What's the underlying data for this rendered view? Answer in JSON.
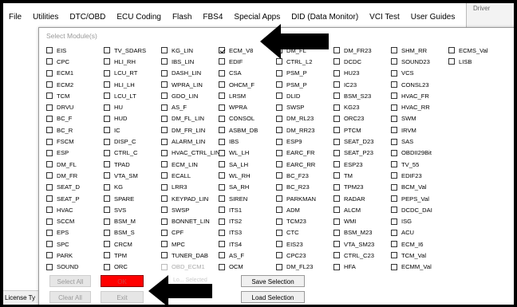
{
  "menubar": {
    "items": [
      "File",
      "Utilities",
      "DTC/OBD",
      "ECU Coding",
      "Flash",
      "FBS4",
      "Special Apps",
      "DID (Data Monitor)",
      "VCI Test",
      "User Guides"
    ]
  },
  "background": {
    "driver_text": "Driver",
    "license_text": "License Ty"
  },
  "dialog": {
    "title": "Select Module(s)",
    "columns": [
      [
        {
          "label": "EIS"
        },
        {
          "label": "CPC"
        },
        {
          "label": "ECM1"
        },
        {
          "label": "ECM2"
        },
        {
          "label": "TCM"
        },
        {
          "label": "DRVU"
        },
        {
          "label": "BC_F"
        },
        {
          "label": "BC_R"
        },
        {
          "label": "FSCM"
        },
        {
          "label": "ESP"
        },
        {
          "label": "DM_FL"
        },
        {
          "label": "DM_FR"
        },
        {
          "label": "SEAT_D"
        },
        {
          "label": "SEAT_P"
        },
        {
          "label": "HVAC"
        },
        {
          "label": "SCCM"
        },
        {
          "label": "EPS"
        },
        {
          "label": "SPC"
        },
        {
          "label": "PARK"
        },
        {
          "label": "SOUND"
        }
      ],
      [
        {
          "label": "TV_SDARS"
        },
        {
          "label": "HLI_RH"
        },
        {
          "label": "LCU_RT"
        },
        {
          "label": "HLI_LH"
        },
        {
          "label": "LCU_LT"
        },
        {
          "label": "HU"
        },
        {
          "label": "HUD"
        },
        {
          "label": "IC"
        },
        {
          "label": "DISP_C"
        },
        {
          "label": "CTRL_C"
        },
        {
          "label": "TPAD"
        },
        {
          "label": "VTA_SM"
        },
        {
          "label": "KG"
        },
        {
          "label": "SPARE"
        },
        {
          "label": "SVS"
        },
        {
          "label": "BSM_M"
        },
        {
          "label": "BSM_S"
        },
        {
          "label": "CRCM"
        },
        {
          "label": "TPM"
        },
        {
          "label": "ORC"
        }
      ],
      [
        {
          "label": "KG_LIN"
        },
        {
          "label": "IBS_LIN"
        },
        {
          "label": "DASH_LIN"
        },
        {
          "label": "WPRA_LIN"
        },
        {
          "label": "GDO_LIN"
        },
        {
          "label": "AS_F"
        },
        {
          "label": "DM_FL_LIN"
        },
        {
          "label": "DM_FR_LIN"
        },
        {
          "label": "ALARM_LIN"
        },
        {
          "label": "HVAC_CTRL_LIN"
        },
        {
          "label": "ECM_LIN"
        },
        {
          "label": "ECALL"
        },
        {
          "label": "LRR3"
        },
        {
          "label": "KEYPAD_LIN"
        },
        {
          "label": "SWSP"
        },
        {
          "label": "BONNET_LIN"
        },
        {
          "label": "CPF"
        },
        {
          "label": "MPC"
        },
        {
          "label": "TUNER_DAB"
        },
        {
          "label": "OBD_ECM1",
          "disabled": true
        }
      ],
      [
        {
          "label": "ECM_V8",
          "checked": true
        },
        {
          "label": "EDIF"
        },
        {
          "label": "CSA"
        },
        {
          "label": "OHCM_F"
        },
        {
          "label": "LRSM"
        },
        {
          "label": "WPRA"
        },
        {
          "label": "CONSOL"
        },
        {
          "label": "ASBM_DB"
        },
        {
          "label": "IBS"
        },
        {
          "label": "WL_LH"
        },
        {
          "label": "SA_LH"
        },
        {
          "label": "WL_RH"
        },
        {
          "label": "SA_RH"
        },
        {
          "label": "SIREN"
        },
        {
          "label": "ITS1"
        },
        {
          "label": "ITS2"
        },
        {
          "label": "ITS3"
        },
        {
          "label": "ITS4"
        },
        {
          "label": "AS_F"
        },
        {
          "label": "OCM"
        }
      ],
      [
        {
          "label": "DM_FL"
        },
        {
          "label": "CTRL_L2"
        },
        {
          "label": "PSM_P"
        },
        {
          "label": "PSM_P"
        },
        {
          "label": "DLID"
        },
        {
          "label": "SWSP"
        },
        {
          "label": "DM_RL23"
        },
        {
          "label": "DM_RR23"
        },
        {
          "label": "ESP9"
        },
        {
          "label": "EARC_FR"
        },
        {
          "label": "EARC_RR"
        },
        {
          "label": "BC_F23"
        },
        {
          "label": "BC_R23"
        },
        {
          "label": "PARKMAN"
        },
        {
          "label": "ADM"
        },
        {
          "label": "TCM23"
        },
        {
          "label": "CTC"
        },
        {
          "label": "EIS23"
        },
        {
          "label": "CPC23"
        },
        {
          "label": "DM_FL23"
        }
      ],
      [
        {
          "label": "DM_FR23"
        },
        {
          "label": "DCDC"
        },
        {
          "label": "HU23"
        },
        {
          "label": "IC23"
        },
        {
          "label": "BSM_S23"
        },
        {
          "label": "KG23"
        },
        {
          "label": "ORC23"
        },
        {
          "label": "PTCM"
        },
        {
          "label": "SEAT_D23"
        },
        {
          "label": "SEAT_P23"
        },
        {
          "label": "ESP23"
        },
        {
          "label": "TM"
        },
        {
          "label": "TPM23"
        },
        {
          "label": "RADAR"
        },
        {
          "label": "ALCM"
        },
        {
          "label": "WMI"
        },
        {
          "label": "BSM_M23"
        },
        {
          "label": "VTA_SM23"
        },
        {
          "label": "CTRL_C23"
        },
        {
          "label": "HFA"
        }
      ],
      [
        {
          "label": "SHM_RR"
        },
        {
          "label": "SOUND23"
        },
        {
          "label": "VCS"
        },
        {
          "label": "CONSL23"
        },
        {
          "label": "HVAC_FR"
        },
        {
          "label": "HVAC_RR"
        },
        {
          "label": "SWM"
        },
        {
          "label": "IRVM"
        },
        {
          "label": "SAS"
        },
        {
          "label": "OBDII29Bit"
        },
        {
          "label": "TV_55"
        },
        {
          "label": "EDIF23"
        },
        {
          "label": "BCM_Val"
        },
        {
          "label": "PEPS_Val"
        },
        {
          "label": "DCDC_DAI"
        },
        {
          "label": "ISG"
        },
        {
          "label": "ACU"
        },
        {
          "label": "ECM_I6"
        },
        {
          "label": "TCM_Val"
        },
        {
          "label": "ECMM_Val"
        }
      ],
      [
        {
          "label": "ECMS_Val"
        },
        {
          "label": "LISB"
        }
      ]
    ],
    "buttons": {
      "select_all": "Select All",
      "ok": "OK",
      "clear_all": "Clear All",
      "exit": "Exit",
      "save_selection": "Save Selection",
      "load_selection": "Load Selection",
      "faint_label": "Lo... Selected"
    }
  },
  "colors": {
    "ok_button": "#ff0000",
    "arrow": "#000000"
  }
}
